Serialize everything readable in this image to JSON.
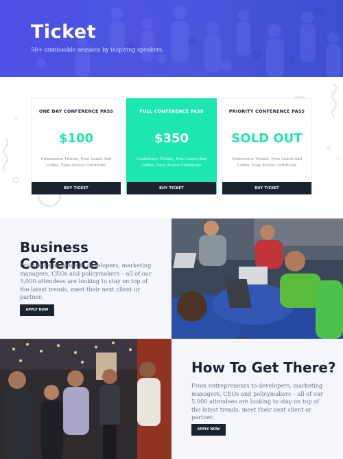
{
  "hero": {
    "title": "Ticket",
    "subtitle": "50+ unmissable sessions by inspiring speakers."
  },
  "pricing": {
    "cards": [
      {
        "name": "ONE DAY CONFERENCE PASS",
        "price": "$100",
        "description": "Conference Tickets, Free Lunch And Coffee, Easy Access Certificate",
        "button": "BUY TICKET"
      },
      {
        "name": "FULL CONFERENCE PASS",
        "price": "$350",
        "description": "Conference Tickets, Free Lunch And Coffee, Easy Access Certificate",
        "button": "BUY TICKET"
      },
      {
        "name": "PRIORITY CONFERENCE PASS",
        "price": "SOLD OUT",
        "description": "Conference Tickets, Free Lunch And Coffee, Easy Access Certificate",
        "button": "BUY TICKET"
      }
    ]
  },
  "business": {
    "title": "Business Confernce",
    "text": "From entrepreneurs to developers, marketing managers, CEOs and policymakers – all of our 5,000 attendees are looking to stay on top of the latest trends, meet their next client or partner.",
    "button": "APPLY NOW"
  },
  "howto": {
    "title": "How To Get There?",
    "text": "From entrepreneurs to developers, marketing managers, CEOs and policymakers – all of our 5,000 attendees are looking to stay on top of the latest trends, meet their next client or partner.",
    "button": "APPLY NOW"
  },
  "colors": {
    "hero_blue": "#4b55de",
    "accent_green": "#1ee6b0",
    "dark_button": "#1b2230",
    "section_bg": "#f4f6fc"
  }
}
